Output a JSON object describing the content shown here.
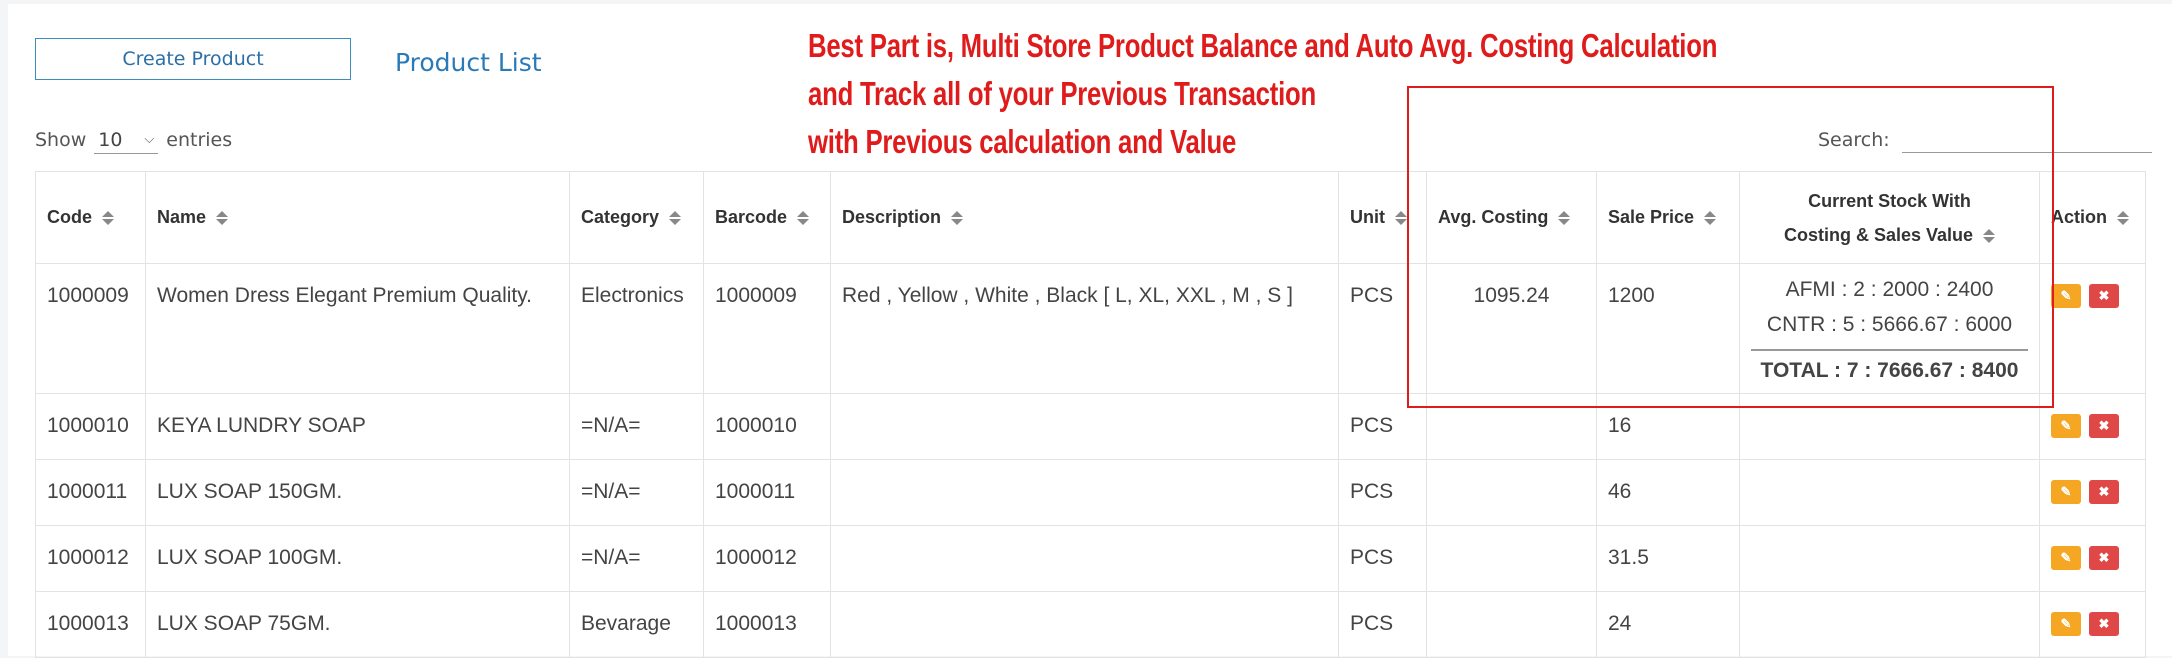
{
  "toolbar": {
    "create_label": "Create Product",
    "list_link": "Product List"
  },
  "promo": [
    "Best Part is, Multi Store Product Balance and Auto Avg. Costing Calculation",
    "and Track all of your Previous Transaction",
    "with Previous calculation and Value"
  ],
  "entries": {
    "show": "Show",
    "value": "10",
    "suffix": "entries"
  },
  "search": {
    "label": "Search:",
    "value": ""
  },
  "columns": {
    "code": "Code",
    "name": "Name",
    "category": "Category",
    "barcode": "Barcode",
    "description": "Description",
    "unit": "Unit",
    "avg": "Avg. Costing",
    "sale": "Sale Price",
    "stock1": "Current Stock With",
    "stock2": "Costing & Sales Value",
    "action": "Action"
  },
  "rows": [
    {
      "code": "1000009",
      "name": "Women Dress Elegant Premium Quality.",
      "category": "Electronics",
      "barcode": "1000009",
      "description": "Red , Yellow , White , Black [ L, XL, XXL , M , S ]",
      "unit": "PCS",
      "avg": "1095.24",
      "sale": "1200",
      "stock": {
        "line1": "AFMI : 2 : 2000 : 2400",
        "line2": "CNTR : 5 : 5666.67 : 6000",
        "total": "TOTAL : 7 : 7666.67 : 8400"
      }
    },
    {
      "code": "1000010",
      "name": "KEYA LUNDRY SOAP",
      "category": "=N/A=",
      "barcode": "1000010",
      "description": "",
      "unit": "PCS",
      "avg": "",
      "sale": "16"
    },
    {
      "code": "1000011",
      "name": "LUX SOAP 150GM.",
      "category": "=N/A=",
      "barcode": "1000011",
      "description": "",
      "unit": "PCS",
      "avg": "",
      "sale": "46"
    },
    {
      "code": "1000012",
      "name": "LUX SOAP 100GM.",
      "category": "=N/A=",
      "barcode": "1000012",
      "description": "",
      "unit": "PCS",
      "avg": "",
      "sale": "31.5"
    },
    {
      "code": "1000013",
      "name": "LUX SOAP 75GM.",
      "category": "Bevarage",
      "barcode": "1000013",
      "description": "",
      "unit": "PCS",
      "avg": "",
      "sale": "24"
    }
  ],
  "icons": {
    "edit": "edit-icon",
    "delete": "delete-icon"
  },
  "colors": {
    "accent": "#2a7ab8",
    "promo": "#e01b1b",
    "edit": "#f5a623",
    "delete": "#e04848"
  }
}
